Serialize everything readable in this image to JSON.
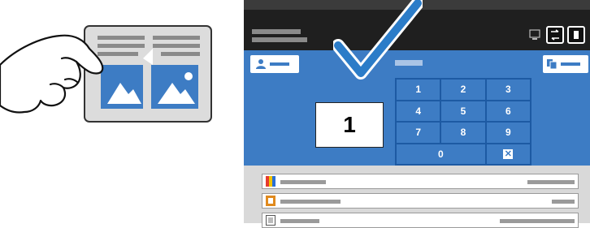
{
  "illustration": {
    "hand": "pointing-hand",
    "document": "document-with-images"
  },
  "status": {
    "icons": [
      "device-status-icon",
      "app-switch-icon",
      "power-icon"
    ]
  },
  "copy": {
    "quantity": "1",
    "keypad": [
      "1",
      "2",
      "3",
      "4",
      "5",
      "6",
      "7",
      "8",
      "9",
      "0"
    ],
    "clear_icon": "clear-icon"
  },
  "check": {
    "icon": "checkmark-icon",
    "color": "#2b7cc8"
  },
  "colors": {
    "panel_blue": "#3d7cc4",
    "dark_bar": "#1f1f1f",
    "list_bg": "#d9d9d9"
  },
  "list": {
    "icons": [
      "color-icon",
      "paper-tray-icon",
      "sides-icon"
    ]
  }
}
